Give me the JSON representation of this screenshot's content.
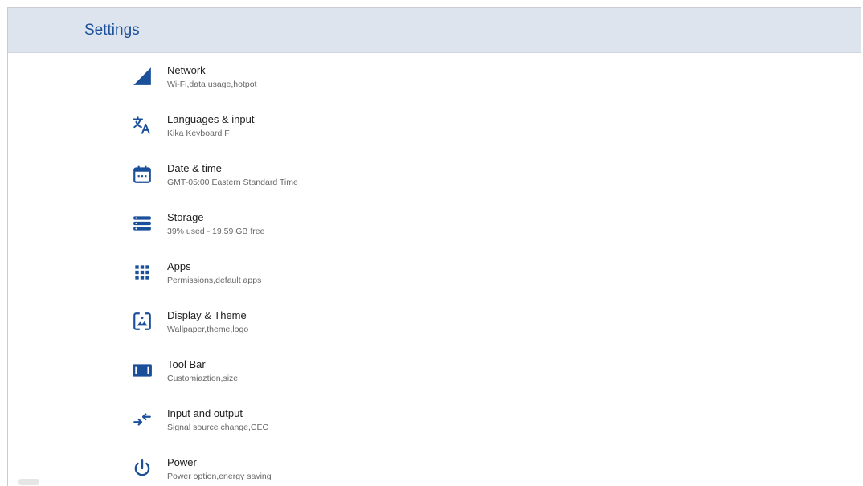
{
  "header": {
    "title": "Settings"
  },
  "items": [
    {
      "icon": "signal-icon",
      "label": "Network",
      "sub": "Wi-Fi,data usage,hotpot"
    },
    {
      "icon": "translate-icon",
      "label": "Languages & input",
      "sub": "Kika Keyboard F"
    },
    {
      "icon": "calendar-icon",
      "label": "Date & time",
      "sub": "GMT-05:00 Eastern Standard Time"
    },
    {
      "icon": "storage-icon",
      "label": "Storage",
      "sub": "39% used - 19.59 GB free"
    },
    {
      "icon": "apps-grid-icon",
      "label": "Apps",
      "sub": "Permissions,default apps"
    },
    {
      "icon": "display-icon",
      "label": "Display & Theme",
      "sub": "Wallpaper,theme,logo"
    },
    {
      "icon": "toolbar-icon",
      "label": "Tool Bar",
      "sub": "Customiaztion,size"
    },
    {
      "icon": "input-output-icon",
      "label": "Input and output",
      "sub": "Signal source change,CEC"
    },
    {
      "icon": "power-icon",
      "label": "Power",
      "sub": "Power option,energy saving"
    }
  ],
  "colors": {
    "accent": "#1a4f99",
    "header_bg": "#dde4ee"
  }
}
